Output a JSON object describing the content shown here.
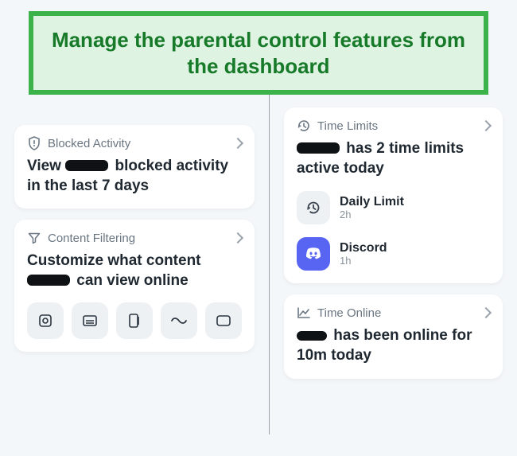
{
  "banner": {
    "text": "Manage the parental control features from the dashboard"
  },
  "left": {
    "blocked": {
      "title": "Blocked Activity",
      "text_before": "View",
      "text_after": "blocked activity in the last 7 days"
    },
    "filtering": {
      "title": "Content Filtering",
      "text_before": "Customize what content",
      "text_after": "can view online"
    }
  },
  "right": {
    "timeLimits": {
      "title": "Time Limits",
      "text_before": "",
      "text_after": "has 2 time limits active today",
      "items": [
        {
          "name": "Daily Limit",
          "sub": "2h"
        },
        {
          "name": "Discord",
          "sub": "1h"
        }
      ]
    },
    "timeOnline": {
      "title": "Time Online",
      "text_before": "",
      "text_after": "has been online for 10m today"
    }
  }
}
